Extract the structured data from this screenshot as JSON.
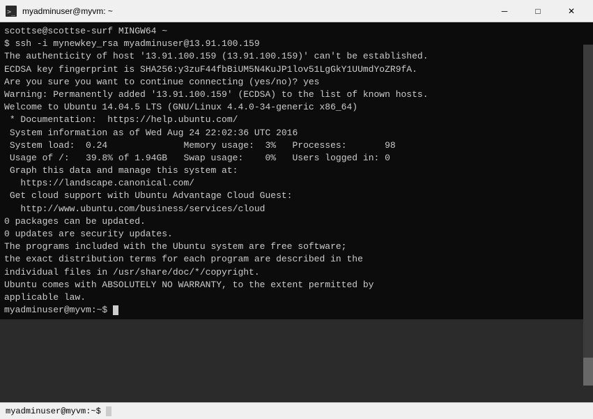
{
  "titlebar": {
    "icon": "terminal-icon",
    "title": "myadminuser@myvm: ~",
    "minimize_label": "─",
    "maximize_label": "□",
    "close_label": "✕"
  },
  "statusbar": {
    "text": "myadminuser@myvm:~$ _"
  },
  "terminal": {
    "lines": [
      {
        "id": "l1",
        "text": "scottse@scottse-surf MINGW64 ~"
      },
      {
        "id": "l2",
        "text": "$ ssh -i mynewkey_rsa myadminuser@13.91.100.159"
      },
      {
        "id": "l3",
        "text": "The authenticity of host '13.91.100.159 (13.91.100.159)' can't be established."
      },
      {
        "id": "l4",
        "text": "ECDSA key fingerprint is SHA256:y3zuF44fbBiUM5N4KuJP1lov51LgGkY1UUmdYoZR9fA."
      },
      {
        "id": "l5",
        "text": "Are you sure you want to continue connecting (yes/no)? yes"
      },
      {
        "id": "l6",
        "text": "Warning: Permanently added '13.91.100.159' (ECDSA) to the list of known hosts."
      },
      {
        "id": "l7",
        "text": "Welcome to Ubuntu 14.04.5 LTS (GNU/Linux 4.4.0-34-generic x86_64)"
      },
      {
        "id": "l8",
        "text": ""
      },
      {
        "id": "l9",
        "text": " * Documentation:  https://help.ubuntu.com/"
      },
      {
        "id": "l10",
        "text": ""
      },
      {
        "id": "l11",
        "text": " System information as of Wed Aug 24 22:02:36 UTC 2016"
      },
      {
        "id": "l12",
        "text": ""
      },
      {
        "id": "l13",
        "text": " System load:  0.24              Memory usage:  3%   Processes:       98"
      },
      {
        "id": "l14",
        "text": " Usage of /:   39.8% of 1.94GB   Swap usage:    0%   Users logged in: 0"
      },
      {
        "id": "l15",
        "text": ""
      },
      {
        "id": "l16",
        "text": " Graph this data and manage this system at:"
      },
      {
        "id": "l17",
        "text": "   https://landscape.canonical.com/"
      },
      {
        "id": "l18",
        "text": ""
      },
      {
        "id": "l19",
        "text": " Get cloud support with Ubuntu Advantage Cloud Guest:"
      },
      {
        "id": "l20",
        "text": "   http://www.ubuntu.com/business/services/cloud"
      },
      {
        "id": "l21",
        "text": ""
      },
      {
        "id": "l22",
        "text": "0 packages can be updated."
      },
      {
        "id": "l23",
        "text": "0 updates are security updates."
      },
      {
        "id": "l24",
        "text": ""
      },
      {
        "id": "l25",
        "text": ""
      },
      {
        "id": "l26",
        "text": "The programs included with the Ubuntu system are free software;"
      },
      {
        "id": "l27",
        "text": "the exact distribution terms for each program are described in the"
      },
      {
        "id": "l28",
        "text": "individual files in /usr/share/doc/*/copyright."
      },
      {
        "id": "l29",
        "text": ""
      },
      {
        "id": "l30",
        "text": "Ubuntu comes with ABSOLUTELY NO WARRANTY, to the extent permitted by"
      },
      {
        "id": "l31",
        "text": "applicable law."
      },
      {
        "id": "l32",
        "text": ""
      }
    ]
  }
}
